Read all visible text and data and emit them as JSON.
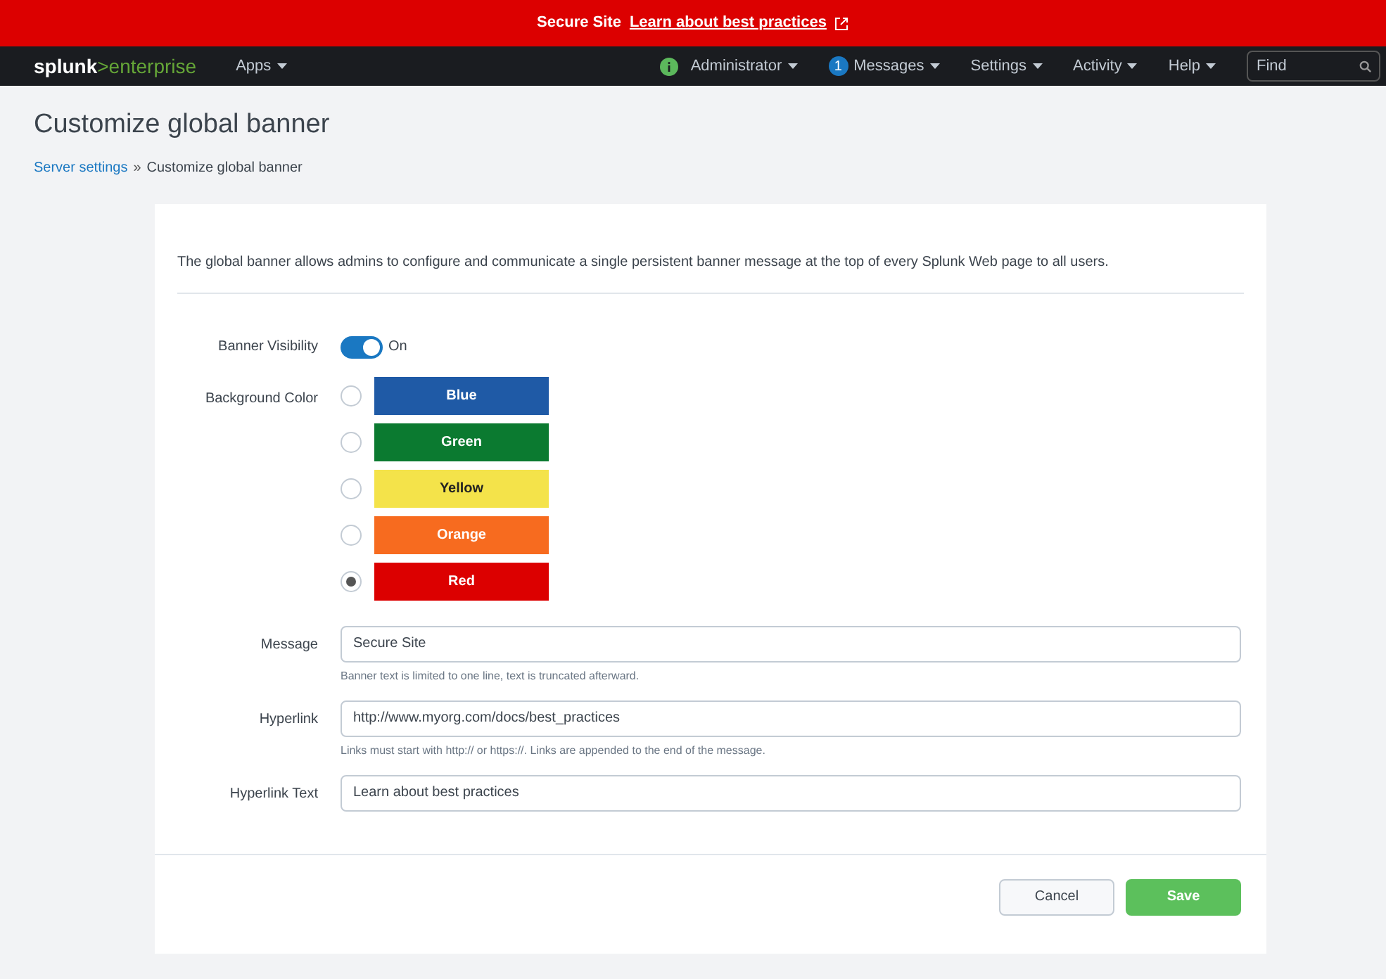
{
  "banner": {
    "message": "Secure Site",
    "link": "Learn about best practices"
  },
  "nav": {
    "brand": "splunk",
    "product": ">enterprise",
    "apps": "Apps",
    "items": [
      {
        "label": "Administrator",
        "kind": "status"
      },
      {
        "label": "Messages",
        "kind": "count",
        "count": "1"
      },
      {
        "label": "Settings",
        "kind": "plain"
      },
      {
        "label": "Activity",
        "kind": "plain"
      },
      {
        "label": "Help",
        "kind": "plain"
      }
    ],
    "search": {
      "placeholder": "Find"
    }
  },
  "page": {
    "title": "Customize global banner",
    "breadcrumb": {
      "parent": "Server settings",
      "separator": "»",
      "current": "Customize global banner"
    }
  },
  "form": {
    "description": "The global banner allows admins to configure and communicate a single persistent banner message at the top of every Splunk Web page to all users.",
    "visibility": {
      "label": "Banner Visibility",
      "on": true,
      "text": "On"
    },
    "background": {
      "label": "Background Color",
      "options": [
        {
          "label": "Blue",
          "color": "#1f5aa6",
          "selected": false
        },
        {
          "label": "Green",
          "color": "#0b7a30",
          "selected": false
        },
        {
          "label": "Yellow",
          "color": "#f4e34a",
          "selected": false
        },
        {
          "label": "Orange",
          "color": "#f76b1f",
          "selected": false
        },
        {
          "label": "Red",
          "color": "#dc0000",
          "selected": true
        }
      ]
    },
    "fields": [
      {
        "label": "Message",
        "value": "Secure Site",
        "help": "Banner text is limited to one line, text is truncated afterward."
      },
      {
        "label": "Hyperlink",
        "value": "http://www.myorg.com/docs/best_practices",
        "help": "Links must start with http:// or https://. Links are appended to the end of the message."
      },
      {
        "label": "Hyperlink Text",
        "value": "Learn about best practices"
      }
    ],
    "buttons": {
      "cancel": "Cancel",
      "save": "Save"
    }
  }
}
